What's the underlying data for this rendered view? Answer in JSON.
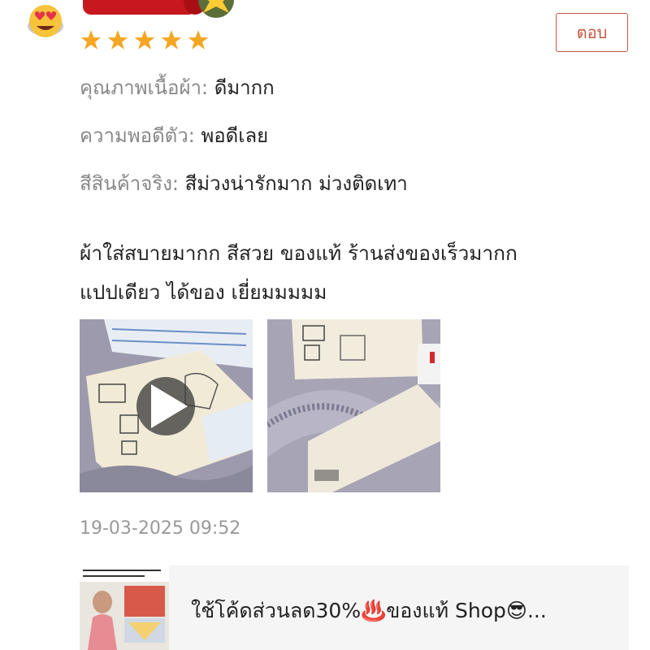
{
  "review": {
    "stars": 5,
    "reply_label": "ตอบ",
    "attributes": [
      {
        "label": "คุณภาพเนื้อผ้า:",
        "value": "ดีมากก"
      },
      {
        "label": "ความพอดีตัว:",
        "value": "พอดีเลย"
      },
      {
        "label": "สีสินค้าจริง:",
        "value": "สีม่วงน่ารักมาก ม่วงติดเทา"
      }
    ],
    "body_line1": "ผ้าใส่สบายมากก สีสวย ของแท้ ร้านส่งของเร็วมากก",
    "body_line2": "แปปเดียว ได้ของ เยี่ยมมมมม",
    "media": [
      {
        "type": "video",
        "icon": "play-icon"
      },
      {
        "type": "image"
      }
    ],
    "date": "19-03-2025 09:52"
  },
  "product": {
    "title": "ใช้โค้ดส่วนลด30%♨️ของแท้ Shop😎..."
  },
  "colors": {
    "accent": "#c75640",
    "star": "#f5a623",
    "muted_text": "#888888",
    "date_text": "#999999",
    "product_bg": "#f5f5f5"
  }
}
